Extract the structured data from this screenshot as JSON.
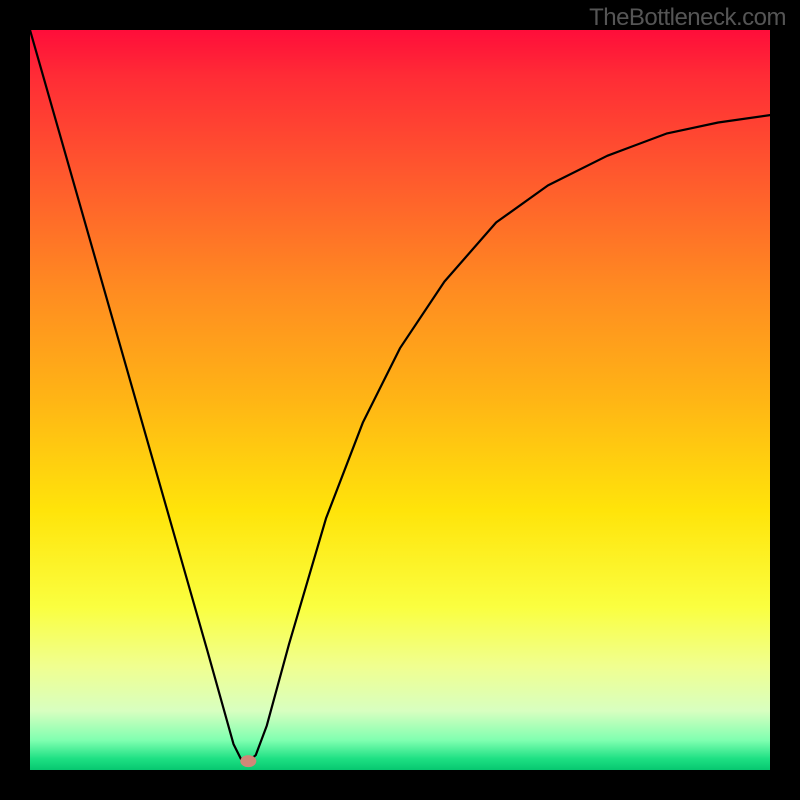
{
  "watermark": "TheBottleneck.com",
  "chart_data": {
    "type": "line",
    "title": "",
    "xlabel": "",
    "ylabel": "",
    "xlim": [
      0,
      1
    ],
    "ylim": [
      0,
      1
    ],
    "gradient_bands": [
      {
        "color": "#ff0d3a",
        "stop": 0.0
      },
      {
        "color": "#ff2b36",
        "stop": 0.06
      },
      {
        "color": "#ff5a2d",
        "stop": 0.2
      },
      {
        "color": "#ff8b21",
        "stop": 0.35
      },
      {
        "color": "#ffb515",
        "stop": 0.5
      },
      {
        "color": "#ffe40a",
        "stop": 0.65
      },
      {
        "color": "#faff40",
        "stop": 0.78
      },
      {
        "color": "#f0ff90",
        "stop": 0.86
      },
      {
        "color": "#d8ffc0",
        "stop": 0.92
      },
      {
        "color": "#7fffb0",
        "stop": 0.96
      },
      {
        "color": "#1de083",
        "stop": 0.985
      },
      {
        "color": "#07c770",
        "stop": 1.0
      }
    ],
    "series": [
      {
        "name": "bottleneck-curve",
        "x": [
          0.0,
          0.04,
          0.08,
          0.12,
          0.16,
          0.2,
          0.24,
          0.275,
          0.285,
          0.295,
          0.305,
          0.32,
          0.35,
          0.4,
          0.45,
          0.5,
          0.56,
          0.63,
          0.7,
          0.78,
          0.86,
          0.93,
          1.0
        ],
        "y": [
          1.0,
          0.86,
          0.72,
          0.58,
          0.44,
          0.3,
          0.16,
          0.035,
          0.015,
          0.012,
          0.02,
          0.06,
          0.17,
          0.34,
          0.47,
          0.57,
          0.66,
          0.74,
          0.79,
          0.83,
          0.86,
          0.875,
          0.885
        ]
      }
    ],
    "marker": {
      "x": 0.295,
      "y": 0.012,
      "color": "#d08878",
      "label": "minimum-point"
    }
  }
}
